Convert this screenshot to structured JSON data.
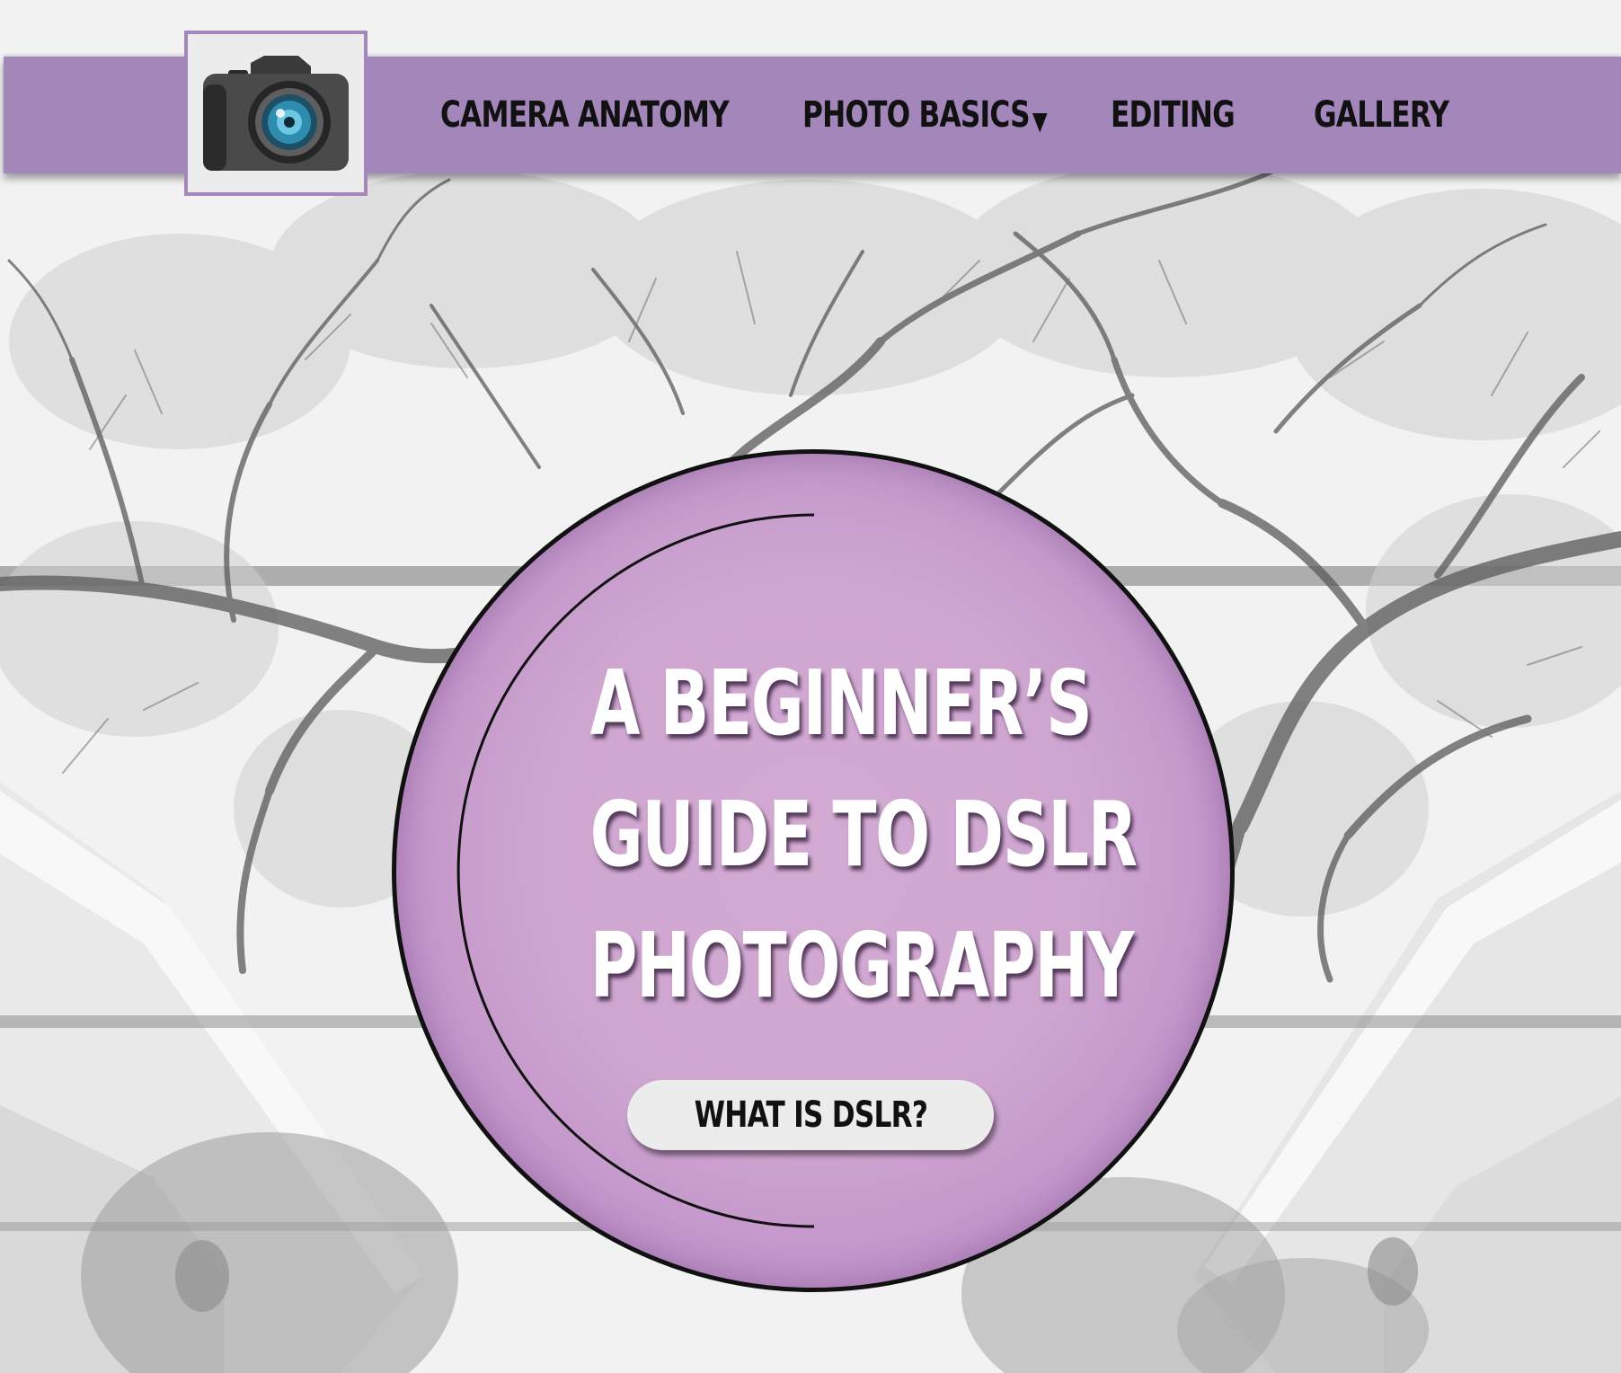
{
  "colors": {
    "accent": "#a386ba",
    "circle": "#cfa6d0",
    "button_bg": "#ececec",
    "text_dark": "#111111",
    "text_light": "#ffffff"
  },
  "header": {
    "logo_icon": "camera-icon",
    "nav": [
      {
        "label": "CAMERA ANATOMY"
      },
      {
        "label": "PHOTO BASICS",
        "caret_icon": "caret-down-icon",
        "caret": "▼"
      },
      {
        "label": "EDITING"
      },
      {
        "label": "GALLERY"
      }
    ]
  },
  "hero": {
    "title_lines": [
      "A BEGINNER’S",
      "GUIDE TO DSLR",
      "PHOTOGRAPHY"
    ],
    "cta_label": "WHAT IS DSLR?"
  }
}
